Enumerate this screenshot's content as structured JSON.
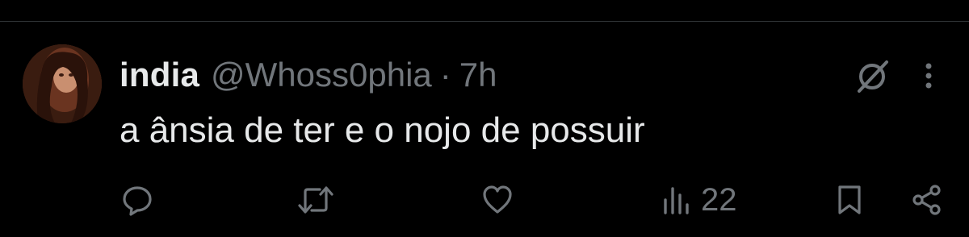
{
  "tweet": {
    "display_name": "india",
    "handle": "@Whoss0phia",
    "separator": "·",
    "time": "7h",
    "text": "a ânsia de ter e o nojo de possuir"
  },
  "actions": {
    "reply_icon": "reply-icon",
    "retweet_icon": "retweet-icon",
    "like_icon": "like-icon",
    "views_icon": "views-icon",
    "views_count": "22",
    "bookmark_icon": "bookmark-icon",
    "share_icon": "share-icon"
  },
  "colors": {
    "background": "#000000",
    "primary_text": "#e7e9ea",
    "secondary_text": "#71767b",
    "divider": "#2f3336"
  }
}
